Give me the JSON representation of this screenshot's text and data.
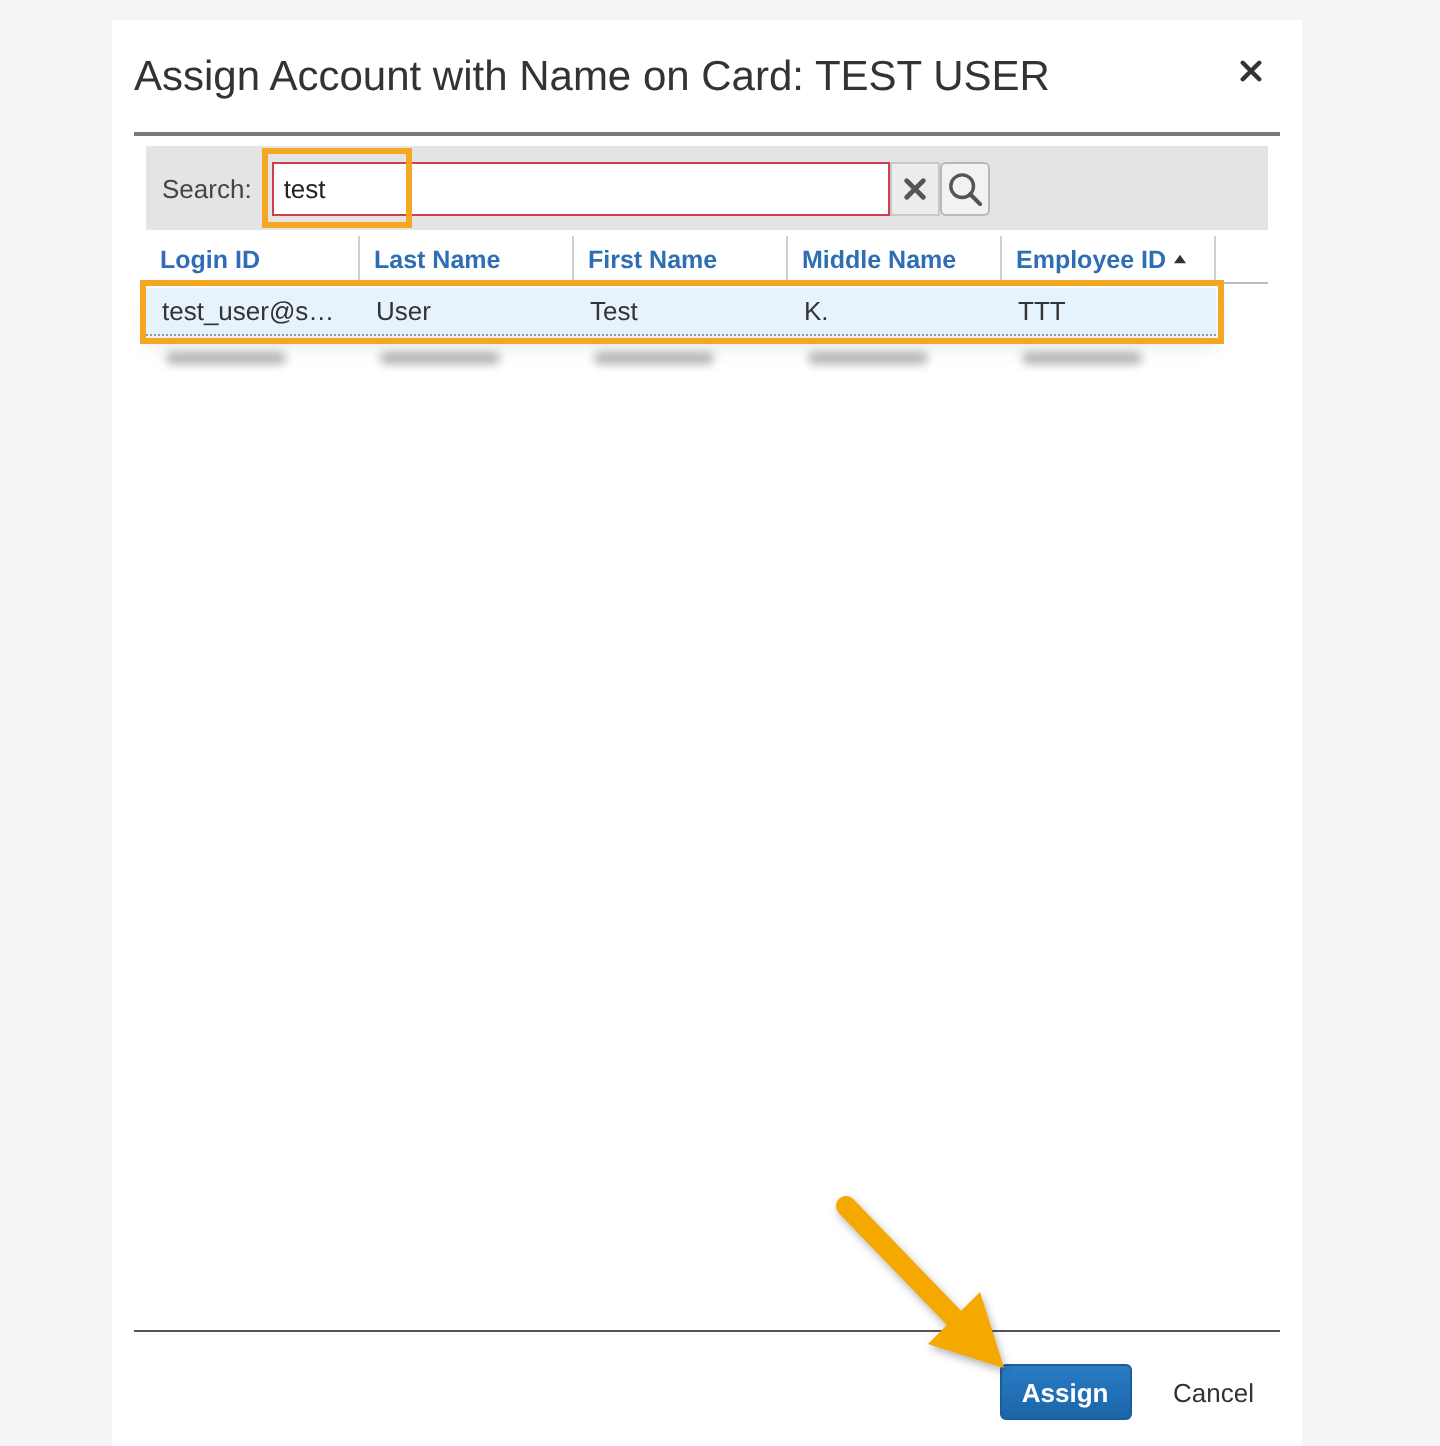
{
  "dialog": {
    "title": "Assign Account with Name on Card: TEST USER"
  },
  "search": {
    "label": "Search:",
    "value": "test",
    "focused": true,
    "highlighted": true
  },
  "table": {
    "columns": [
      {
        "label": "Login ID",
        "sorted": false
      },
      {
        "label": "Last Name",
        "sorted": false
      },
      {
        "label": "First Name",
        "sorted": false
      },
      {
        "label": "Middle Name",
        "sorted": false
      },
      {
        "label": "Employee ID",
        "sorted": true
      }
    ],
    "rows": [
      {
        "cells": [
          "test_user@s…",
          "User",
          "Test",
          "K.",
          "TTT"
        ],
        "selected": true,
        "highlighted": true
      }
    ]
  },
  "buttons": [
    {
      "kind": "primary",
      "label": "Assign",
      "pointed_at": true
    },
    {
      "kind": "link",
      "label": "Cancel",
      "pointed_at": false
    }
  ]
}
